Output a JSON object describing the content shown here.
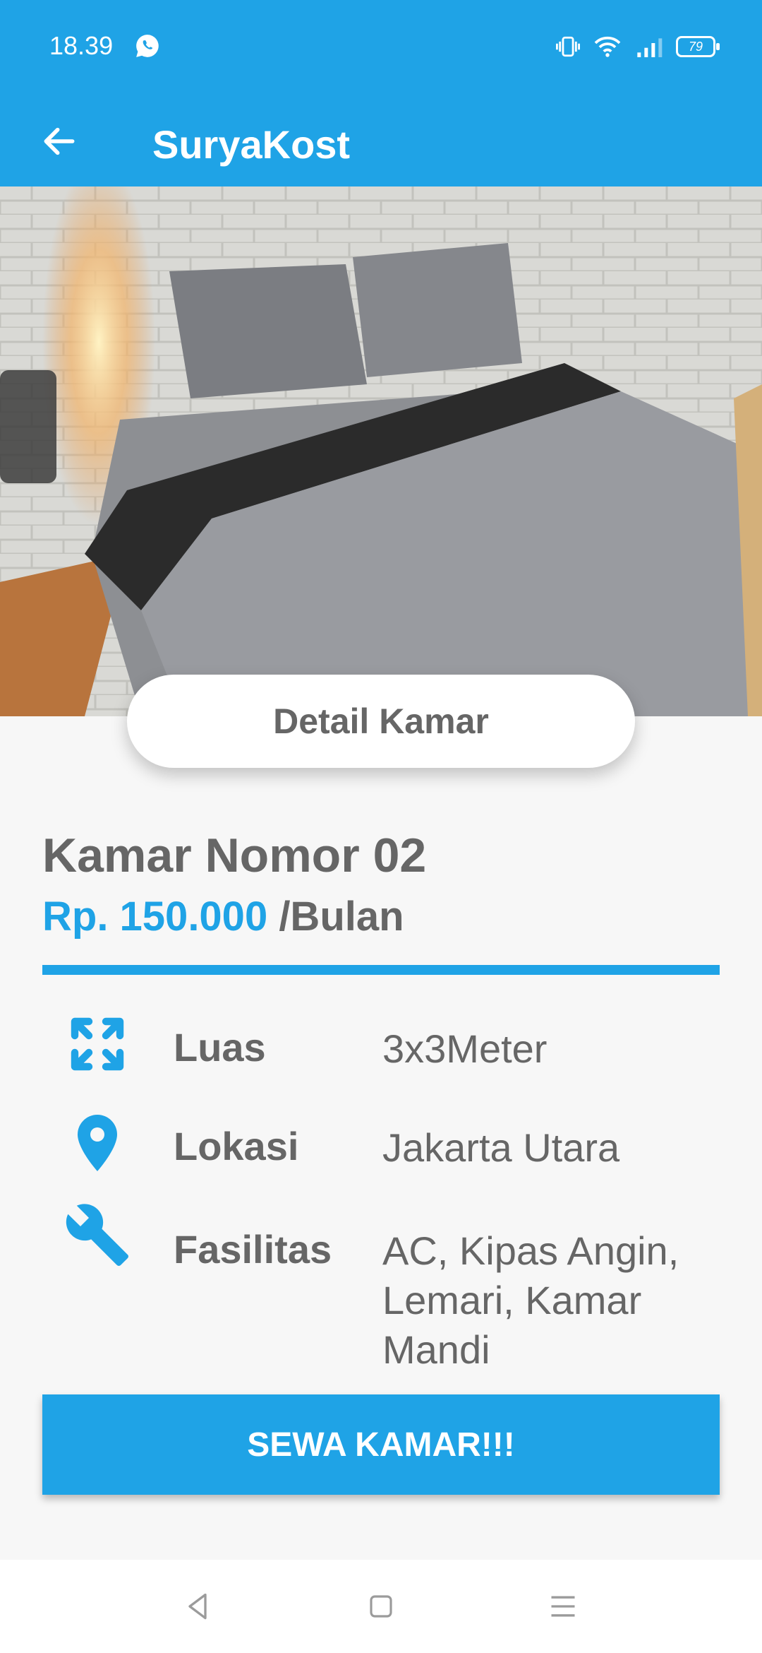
{
  "status": {
    "time": "18.39",
    "battery": "79"
  },
  "appbar": {
    "title": "SuryaKost"
  },
  "detail": {
    "pill_label": "Detail Kamar",
    "room_title": "Kamar Nomor 02",
    "price": "Rp. 150.000",
    "price_unit": " /Bulan",
    "rows": [
      {
        "label": "Luas",
        "value": "3x3Meter"
      },
      {
        "label": "Lokasi",
        "value": "Jakarta Utara"
      },
      {
        "label": "Fasilitas",
        "value": "AC, Kipas Angin, Lemari, Kamar Mandi"
      }
    ]
  },
  "cta": {
    "label": "SEWA KAMAR!!!"
  },
  "colors": {
    "primary": "#1fa3e6",
    "text": "#666666"
  }
}
